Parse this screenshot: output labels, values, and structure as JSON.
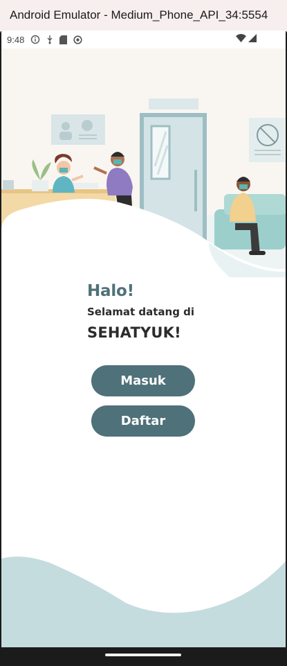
{
  "window": {
    "title": "Android Emulator - Medium_Phone_API_34:5554"
  },
  "status_bar": {
    "time": "9:48",
    "icons": [
      "info-icon",
      "usb-debug-icon",
      "sd-card-icon",
      "sync-icon",
      "wifi-icon",
      "signal-icon"
    ]
  },
  "welcome": {
    "greeting": "Halo!",
    "subtitle": "Selamat datang di",
    "app_name": "SEHATYUK!"
  },
  "buttons": {
    "login_label": "Masuk",
    "register_label": "Daftar"
  },
  "colors": {
    "accent": "#4f7179",
    "wave": "#c5dcdf",
    "wall": "#f9f6f1",
    "text_dark": "#2b2b2b"
  }
}
